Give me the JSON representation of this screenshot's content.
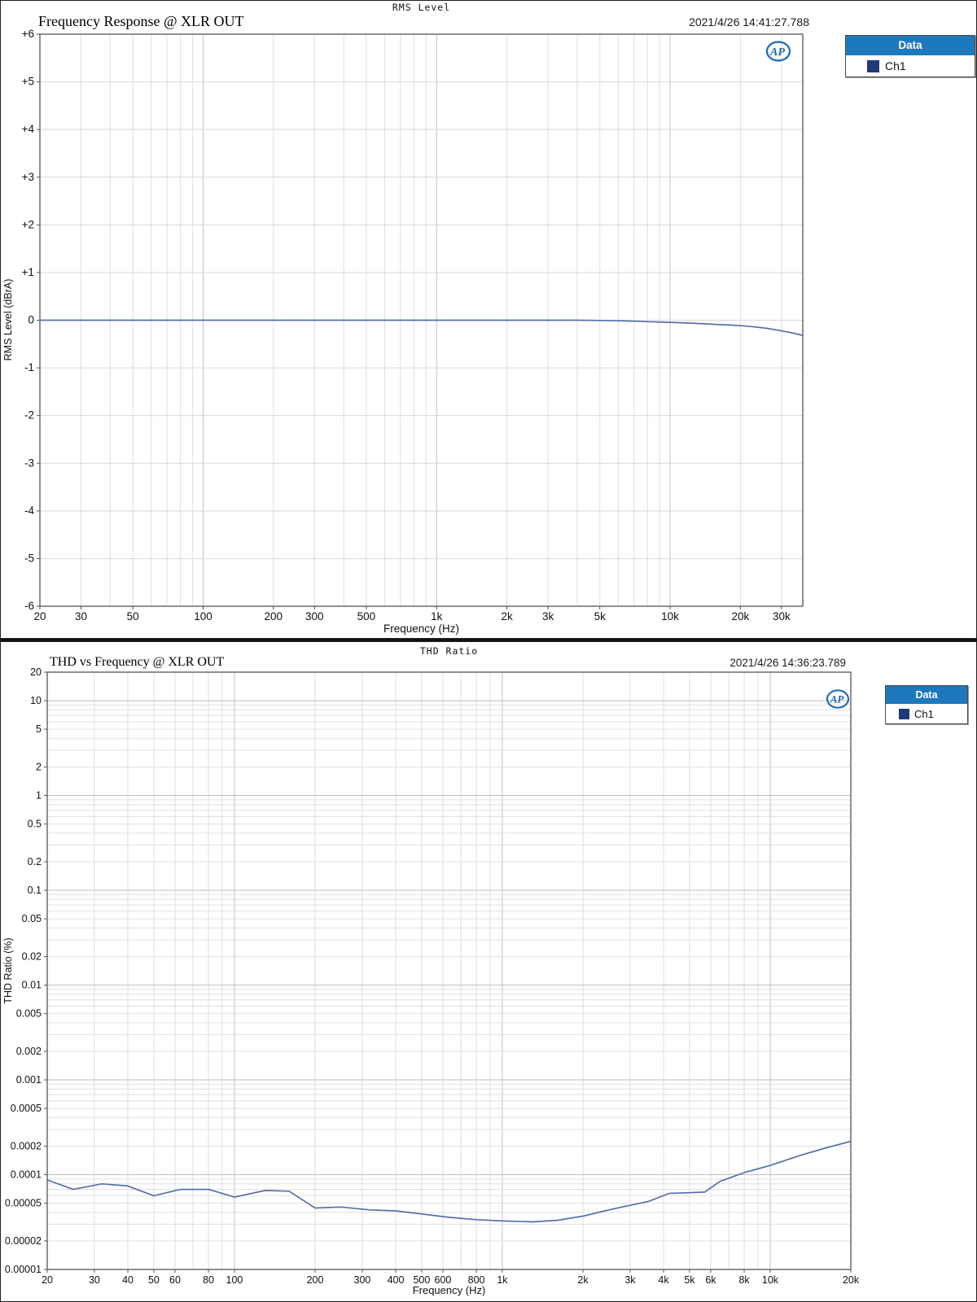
{
  "colors": {
    "series_line": "#5570a8",
    "legend_header_bg": "#1e78bc",
    "legend_swatch": "#1e3a78",
    "ap_logo_blue": "#1a6ab5",
    "grid_minor": "#dedede",
    "grid_major": "#c2c2c2",
    "plot_border": "#757575"
  },
  "ap_logo_text": "AP",
  "chart_data": [
    {
      "type": "line",
      "header_label": "RMS Level",
      "title": "Frequency Response @ XLR OUT",
      "timestamp": "2021/4/26 14:41:27.788",
      "xlabel": "Frequency (Hz)",
      "ylabel": "RMS Level (dBrA)",
      "x_scale": "log",
      "y_scale": "linear",
      "xlim": [
        20,
        37000
      ],
      "ylim": [
        -6,
        6
      ],
      "grid": true,
      "x_ticks": [
        {
          "v": 20,
          "label": "20"
        },
        {
          "v": 30,
          "label": "30"
        },
        {
          "v": 50,
          "label": "50"
        },
        {
          "v": 100,
          "label": "100"
        },
        {
          "v": 200,
          "label": "200"
        },
        {
          "v": 300,
          "label": "300"
        },
        {
          "v": 500,
          "label": "500"
        },
        {
          "v": 1000,
          "label": "1k"
        },
        {
          "v": 2000,
          "label": "2k"
        },
        {
          "v": 3000,
          "label": "3k"
        },
        {
          "v": 5000,
          "label": "5k"
        },
        {
          "v": 10000,
          "label": "10k"
        },
        {
          "v": 20000,
          "label": "20k"
        },
        {
          "v": 30000,
          "label": "30k"
        }
      ],
      "y_ticks": [
        {
          "v": 6,
          "label": "+6"
        },
        {
          "v": 5,
          "label": "+5"
        },
        {
          "v": 4,
          "label": "+4"
        },
        {
          "v": 3,
          "label": "+3"
        },
        {
          "v": 2,
          "label": "+2"
        },
        {
          "v": 1,
          "label": "+1"
        },
        {
          "v": 0,
          "label": "0"
        },
        {
          "v": -1,
          "label": "-1"
        },
        {
          "v": -2,
          "label": "-2"
        },
        {
          "v": -3,
          "label": "-3"
        },
        {
          "v": -4,
          "label": "-4"
        },
        {
          "v": -5,
          "label": "-5"
        },
        {
          "v": -6,
          "label": "-6"
        }
      ],
      "legend": {
        "header": "Data",
        "position": "outside-top-right",
        "items": [
          {
            "name": "Ch1",
            "swatch_color": "#1e3a78"
          }
        ]
      },
      "series": [
        {
          "name": "Ch1",
          "color": "#5570a8",
          "points": [
            [
              20,
              0
            ],
            [
              50,
              0
            ],
            [
              100,
              0
            ],
            [
              200,
              0
            ],
            [
              500,
              0
            ],
            [
              1000,
              0
            ],
            [
              2000,
              0
            ],
            [
              3000,
              0
            ],
            [
              4000,
              0
            ],
            [
              5000,
              -0.005
            ],
            [
              6000,
              -0.012
            ],
            [
              7000,
              -0.02
            ],
            [
              8000,
              -0.03
            ],
            [
              10000,
              -0.045
            ],
            [
              12000,
              -0.06
            ],
            [
              14000,
              -0.075
            ],
            [
              16000,
              -0.09
            ],
            [
              18000,
              -0.1
            ],
            [
              20000,
              -0.115
            ],
            [
              23000,
              -0.14
            ],
            [
              26000,
              -0.17
            ],
            [
              29000,
              -0.21
            ],
            [
              32000,
              -0.25
            ],
            [
              35000,
              -0.29
            ],
            [
              37000,
              -0.32
            ]
          ]
        }
      ]
    },
    {
      "type": "line",
      "header_label": "THD Ratio",
      "title": "THD vs Frequency @ XLR OUT",
      "timestamp": "2021/4/26 14:36:23.789",
      "xlabel": "Frequency (Hz)",
      "ylabel": "THD Ratio (%)",
      "x_scale": "log",
      "y_scale": "log",
      "xlim": [
        20,
        20000
      ],
      "ylim": [
        1e-05,
        20
      ],
      "grid": true,
      "x_ticks": [
        {
          "v": 20,
          "label": "20"
        },
        {
          "v": 30,
          "label": "30"
        },
        {
          "v": 40,
          "label": "40"
        },
        {
          "v": 50,
          "label": "50"
        },
        {
          "v": 60,
          "label": "60"
        },
        {
          "v": 80,
          "label": "80"
        },
        {
          "v": 100,
          "label": "100"
        },
        {
          "v": 200,
          "label": "200"
        },
        {
          "v": 300,
          "label": "300"
        },
        {
          "v": 400,
          "label": "400"
        },
        {
          "v": 500,
          "label": "500"
        },
        {
          "v": 600,
          "label": "600"
        },
        {
          "v": 800,
          "label": "800"
        },
        {
          "v": 1000,
          "label": "1k"
        },
        {
          "v": 2000,
          "label": "2k"
        },
        {
          "v": 3000,
          "label": "3k"
        },
        {
          "v": 4000,
          "label": "4k"
        },
        {
          "v": 5000,
          "label": "5k"
        },
        {
          "v": 6000,
          "label": "6k"
        },
        {
          "v": 8000,
          "label": "8k"
        },
        {
          "v": 10000,
          "label": "10k"
        },
        {
          "v": 20000,
          "label": "20k"
        }
      ],
      "y_ticks": [
        {
          "v": 20,
          "label": "20"
        },
        {
          "v": 10,
          "label": "10"
        },
        {
          "v": 5,
          "label": "5"
        },
        {
          "v": 2,
          "label": "2"
        },
        {
          "v": 1,
          "label": "1"
        },
        {
          "v": 0.5,
          "label": "0.5"
        },
        {
          "v": 0.2,
          "label": "0.2"
        },
        {
          "v": 0.1,
          "label": "0.1"
        },
        {
          "v": 0.05,
          "label": "0.05"
        },
        {
          "v": 0.02,
          "label": "0.02"
        },
        {
          "v": 0.01,
          "label": "0.01"
        },
        {
          "v": 0.005,
          "label": "0.005"
        },
        {
          "v": 0.002,
          "label": "0.002"
        },
        {
          "v": 0.001,
          "label": "0.001"
        },
        {
          "v": 0.0005,
          "label": "0.0005"
        },
        {
          "v": 0.0002,
          "label": "0.0002"
        },
        {
          "v": 0.0001,
          "label": "0.0001"
        },
        {
          "v": 5e-05,
          "label": "0.00005"
        },
        {
          "v": 2e-05,
          "label": "0.00002"
        },
        {
          "v": 1e-05,
          "label": "0.00001"
        }
      ],
      "legend": {
        "header": "Data",
        "position": "outside-top-right",
        "items": [
          {
            "name": "Ch1",
            "swatch_color": "#1e3a78"
          }
        ]
      },
      "series": [
        {
          "name": "Ch1",
          "color": "#5570a8",
          "points": [
            [
              20,
              8.8e-05
            ],
            [
              25,
              7e-05
            ],
            [
              32,
              8e-05
            ],
            [
              40,
              7.6e-05
            ],
            [
              50,
              6e-05
            ],
            [
              63,
              7e-05
            ],
            [
              80,
              7e-05
            ],
            [
              100,
              5.8e-05
            ],
            [
              130,
              6.8e-05
            ],
            [
              160,
              6.7e-05
            ],
            [
              200,
              4.45e-05
            ],
            [
              250,
              4.55e-05
            ],
            [
              320,
              4.25e-05
            ],
            [
              400,
              4.15e-05
            ],
            [
              500,
              3.85e-05
            ],
            [
              630,
              3.55e-05
            ],
            [
              800,
              3.35e-05
            ],
            [
              1000,
              3.25e-05
            ],
            [
              1300,
              3.18e-05
            ],
            [
              1600,
              3.3e-05
            ],
            [
              2000,
              3.65e-05
            ],
            [
              2500,
              4.25e-05
            ],
            [
              3000,
              4.75e-05
            ],
            [
              3500,
              5.2e-05
            ],
            [
              4200,
              6.35e-05
            ],
            [
              5000,
              6.45e-05
            ],
            [
              5700,
              6.55e-05
            ],
            [
              6500,
              8.5e-05
            ],
            [
              8000,
              0.000105
            ],
            [
              10000,
              0.000125
            ],
            [
              13000,
              0.00016
            ],
            [
              16000,
              0.00019
            ],
            [
              20000,
              0.000225
            ]
          ]
        }
      ]
    }
  ]
}
